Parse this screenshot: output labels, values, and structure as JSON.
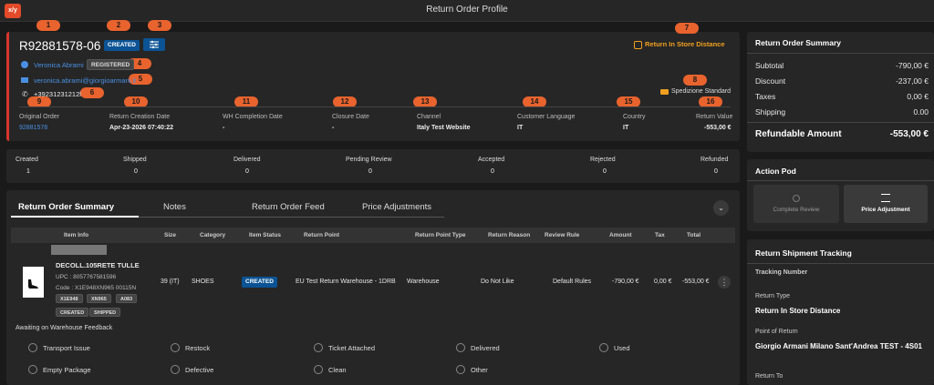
{
  "app": {
    "logo_text": "x/y",
    "title": "Return Order Profile"
  },
  "annotations": [
    "1",
    "2",
    "3",
    "4",
    "5",
    "6",
    "7",
    "8",
    "9",
    "10",
    "11",
    "12",
    "13",
    "14",
    "15",
    "16"
  ],
  "header": {
    "order_id": "R92881578-06",
    "status": "CREATED",
    "return_type_link": "Return In Store Distance",
    "customer_name": "Veronica Abrami",
    "customer_status": "REGISTERED",
    "email": "veronica.abrami@giorgioarmani.it",
    "phone": "+39231231212l",
    "shipping": "Spedizione Standard"
  },
  "info": {
    "labels": [
      "Original Order",
      "Return Creation Date",
      "WH Completion Date",
      "Closure Date",
      "Channel",
      "Customer Language",
      "Country",
      "Return Value"
    ],
    "values": [
      "92881578",
      "Apr-23-2026 07:40:22",
      "-",
      "-",
      "Italy Test Website",
      "IT",
      "IT",
      "-553,00 €"
    ]
  },
  "counts": {
    "labels": [
      "Created",
      "Shipped",
      "Delivered",
      "Pending Review",
      "Accepted",
      "Rejected",
      "Refunded"
    ],
    "values": [
      "1",
      "0",
      "0",
      "0",
      "0",
      "0",
      "0"
    ]
  },
  "tabs": [
    "Return Order Summary",
    "Notes",
    "Return Order Feed",
    "Price Adjustments"
  ],
  "table": {
    "headers": [
      "Item Info",
      "Size",
      "Category",
      "Item Status",
      "Return Point",
      "Return Point Type",
      "Return Reason",
      "Review Rule",
      "Amount",
      "Tax",
      "Total"
    ],
    "row": {
      "name": "DECOLL.105RETE TULLE",
      "upc": "UPC : 8057767581596",
      "code": "Code : X1E948XN965 00115N",
      "code_chips": [
        "X1E948",
        "XN965",
        "A083"
      ],
      "status_chips": [
        "CREATED",
        "SHIPPED"
      ],
      "size": "39 (IT)",
      "category": "SHOES",
      "item_status": "CREATED",
      "return_point": "EU Test Return Warehouse - 1DRB",
      "return_point_type": "Warehouse",
      "return_reason": "Do Not Like",
      "review_rule": "Default Rules",
      "amount": "-790,00 €",
      "tax": "0,00 €",
      "total": "-553,00 €"
    }
  },
  "feedback": {
    "title": "Awaiting on Warehouse Feedback",
    "options": [
      "Transport Issue",
      "Restock",
      "Ticket Attached",
      "Delivered",
      "Used",
      "Empty Package",
      "Defective",
      "Clean",
      "Other"
    ]
  },
  "summary": {
    "title": "Return Order Summary",
    "rows": [
      {
        "label": "Subtotal",
        "value": "-790,00 €"
      },
      {
        "label": "Discount",
        "value": "-237,00 €"
      },
      {
        "label": "Taxes",
        "value": "0,00 €"
      },
      {
        "label": "Shipping",
        "value": "0.00"
      }
    ],
    "refundable_label": "Refundable Amount",
    "refundable_value": "-553,00 €"
  },
  "action_pod": {
    "title": "Action Pod",
    "complete_review": "Complete Review",
    "price_adjustment": "Price Adjustment"
  },
  "tracking": {
    "title": "Return Shipment Tracking",
    "tracking_number_label": "Tracking Number",
    "return_type_label": "Return Type",
    "return_type_value": "Return In Store Distance",
    "point_label": "Point of Return",
    "point_value": "Giorgio Armani Milano Sant'Andrea TEST - 4S01",
    "return_to_label": "Return To"
  },
  "colors": {
    "accent_orange": "#e8632e",
    "link_blue": "#4a90e2",
    "status_blue": "#0b5394",
    "danger_red": "#d9342b",
    "store_orange": "#f0a020"
  }
}
